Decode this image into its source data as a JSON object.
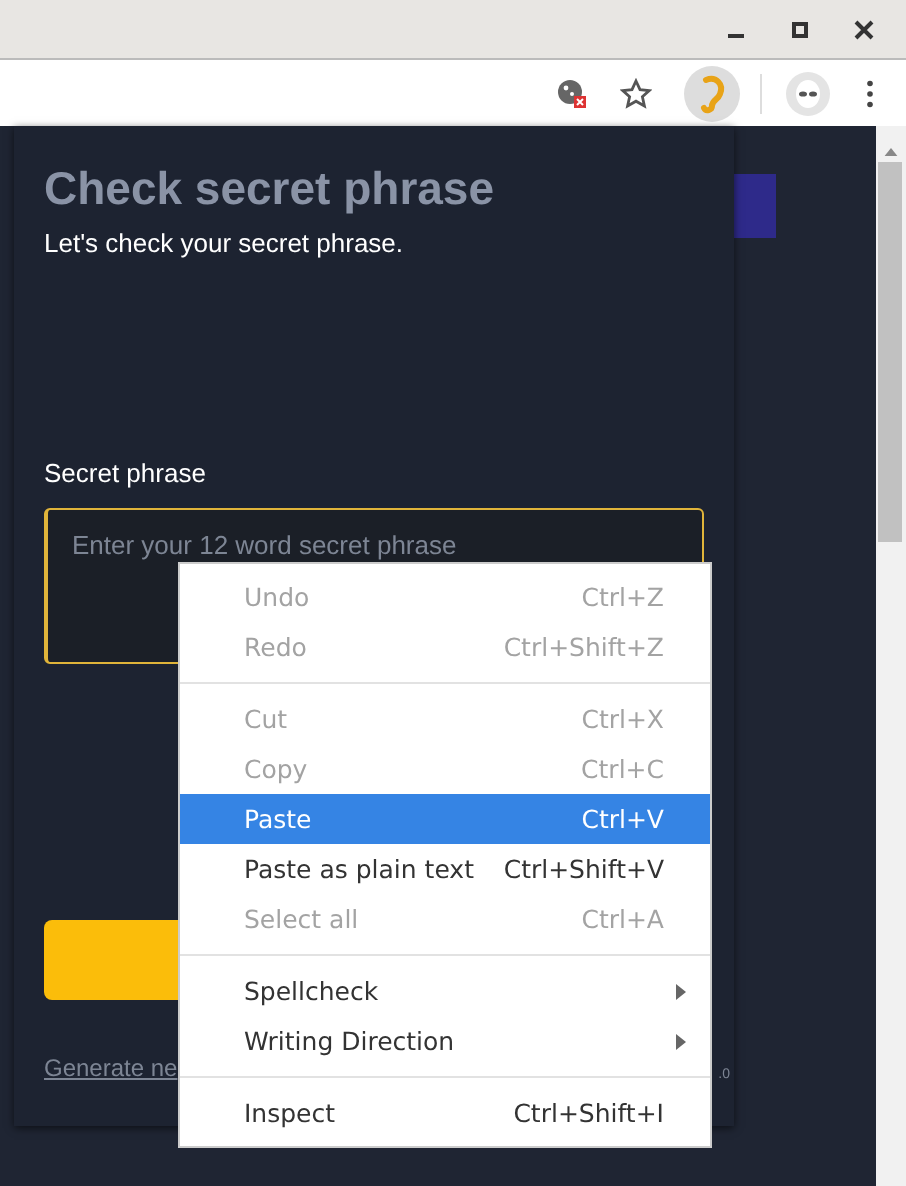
{
  "window": {
    "controls": [
      {
        "kind": "minimize"
      },
      {
        "kind": "maximize"
      },
      {
        "kind": "close"
      }
    ]
  },
  "popup": {
    "title": "Check secret phrase",
    "subtitle": "Let's check your secret phrase.",
    "field_label": "Secret phrase",
    "field": {
      "placeholder": "Enter your 12 word secret phrase"
    },
    "link": "Generate ne",
    "version": ".0"
  },
  "context_menu": [
    {
      "kind": "item",
      "label": "Undo",
      "shortcut": "Ctrl+Z",
      "disabled": true,
      "selected": false,
      "submenu": false
    },
    {
      "kind": "item",
      "label": "Redo",
      "shortcut": "Ctrl+Shift+Z",
      "disabled": true,
      "selected": false,
      "submenu": false
    },
    {
      "kind": "separator"
    },
    {
      "kind": "item",
      "label": "Cut",
      "shortcut": "Ctrl+X",
      "disabled": true,
      "selected": false,
      "submenu": false
    },
    {
      "kind": "item",
      "label": "Copy",
      "shortcut": "Ctrl+C",
      "disabled": true,
      "selected": false,
      "submenu": false
    },
    {
      "kind": "item",
      "label": "Paste",
      "shortcut": "Ctrl+V",
      "disabled": false,
      "selected": true,
      "submenu": false
    },
    {
      "kind": "item",
      "label": "Paste as plain text",
      "shortcut": "Ctrl+Shift+V",
      "disabled": false,
      "selected": false,
      "submenu": false
    },
    {
      "kind": "item",
      "label": "Select all",
      "shortcut": "Ctrl+A",
      "disabled": true,
      "selected": false,
      "submenu": false
    },
    {
      "kind": "separator"
    },
    {
      "kind": "item",
      "label": "Spellcheck",
      "disabled": false,
      "selected": false,
      "submenu": true
    },
    {
      "kind": "item",
      "label": "Writing Direction",
      "disabled": false,
      "selected": false,
      "submenu": true
    },
    {
      "kind": "separator"
    },
    {
      "kind": "item",
      "label": "Inspect",
      "shortcut": "Ctrl+Shift+I",
      "disabled": false,
      "selected": false,
      "submenu": false
    }
  ]
}
